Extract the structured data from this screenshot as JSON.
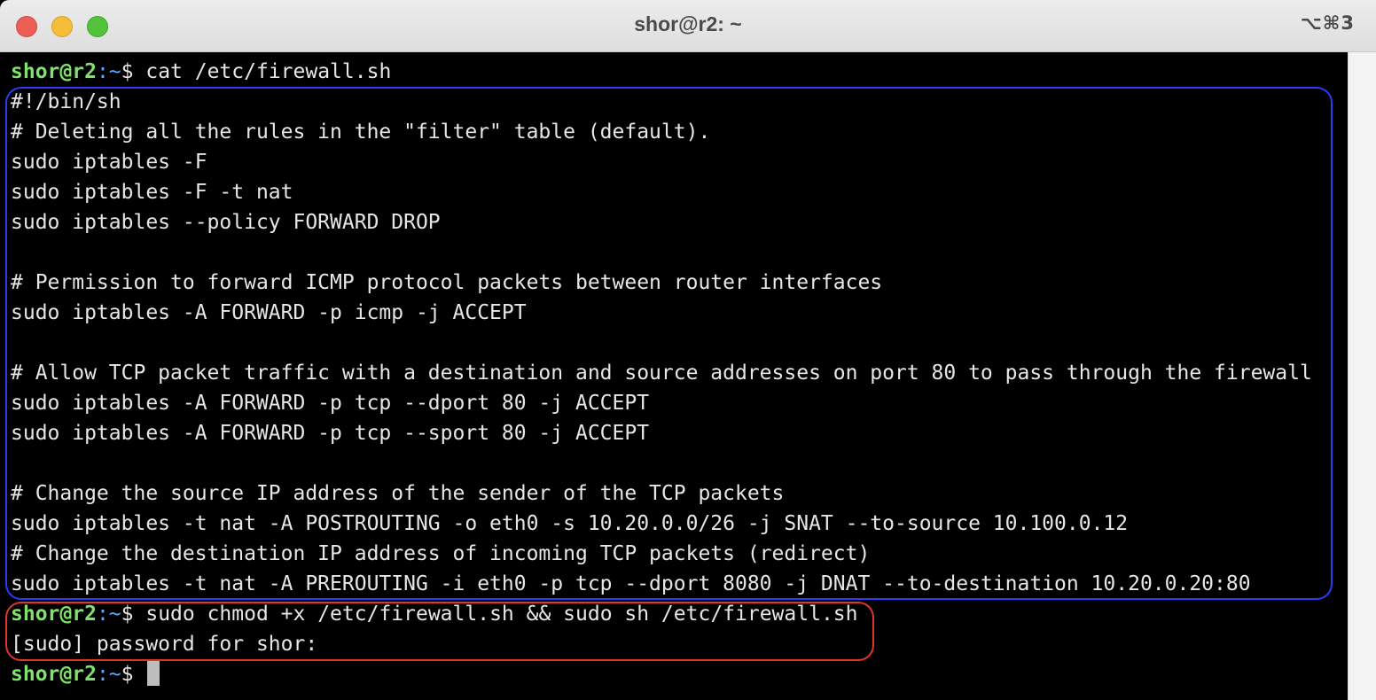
{
  "window": {
    "title": "shor@r2: ~",
    "shortcut": "⌥⌘3"
  },
  "terminal": {
    "prompt_user": "shor@r2",
    "prompt_path": ":~",
    "prompt_symbol": "$ ",
    "command_1": "cat /etc/firewall.sh",
    "file_lines": [
      "#!/bin/sh",
      "# Deleting all the rules in the \"filter\" table (default).",
      "sudo iptables -F",
      "sudo iptables -F -t nat",
      "sudo iptables --policy FORWARD DROP",
      "",
      "# Permission to forward ICMP protocol packets between router interfaces",
      "sudo iptables -A FORWARD -p icmp -j ACCEPT",
      "",
      "# Allow TCP packet traffic with a destination and source addresses on port 80 to pass through the firewall",
      "sudo iptables -A FORWARD -p tcp --dport 80 -j ACCEPT",
      "sudo iptables -A FORWARD -p tcp --sport 80 -j ACCEPT",
      "",
      "# Change the source IP address of the sender of the TCP packets",
      "sudo iptables -t nat -A POSTROUTING -o eth0 -s 10.20.0.0/26 -j SNAT --to-source 10.100.0.12",
      "# Change the destination IP address of incoming TCP packets (redirect)",
      "sudo iptables -t nat -A PREROUTING -i eth0 -p tcp --dport 8080 -j DNAT --to-destination 10.20.0.20:80"
    ],
    "command_2": "sudo chmod +x /etc/firewall.sh && sudo sh /etc/firewall.sh",
    "sudo_prompt": "[sudo] password for shor:"
  },
  "colors": {
    "prompt_user": "#7ee36a",
    "prompt_path": "#5aa7ff",
    "highlight_blue": "#2a3cf5",
    "highlight_red": "#e0362b"
  }
}
